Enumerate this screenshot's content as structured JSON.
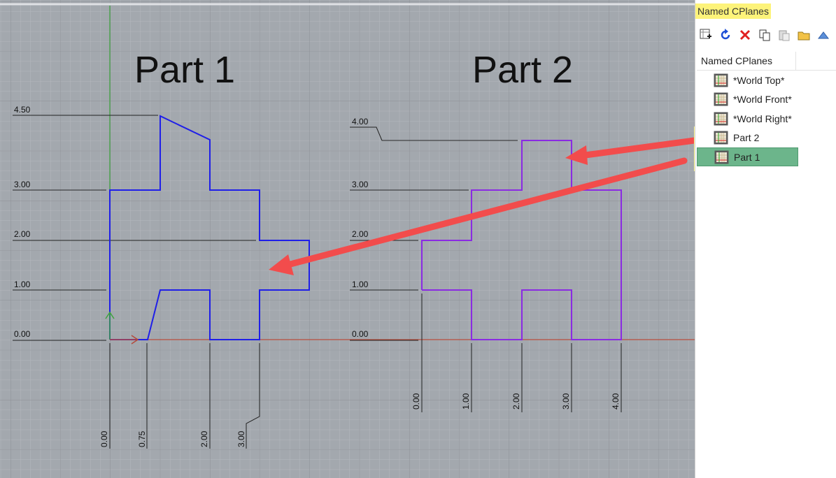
{
  "viewport": {
    "part1_title": "Part 1",
    "part2_title": "Part 2",
    "part1_y_labels": [
      "4.50",
      "3.00",
      "2.00",
      "1.00",
      "0.00"
    ],
    "part1_x_labels": [
      "0.00",
      "0.75",
      "2.00",
      "3.00"
    ],
    "part2_y_labels": [
      "4.00",
      "3.00",
      "2.00",
      "1.00",
      "0.00"
    ],
    "part2_x_labels": [
      "0.00",
      "1.00",
      "2.00",
      "3.00",
      "4.00"
    ],
    "colors": {
      "background": "#a3a8ae",
      "part1_outline": "#1f1fe8",
      "part2_outline": "#8a2be2",
      "annotation_arrow": "#f24c4c",
      "x_axis": "#b54a3a",
      "y_axis": "#3ea33e"
    }
  },
  "panel": {
    "title": "Named CPlanes",
    "toolbar": [
      {
        "name": "new-cplane-icon",
        "glyph": "⊞"
      },
      {
        "name": "restore-icon",
        "glyph": "↻"
      },
      {
        "name": "delete-icon",
        "glyph": "✕"
      },
      {
        "name": "copy-icon",
        "glyph": "❐"
      },
      {
        "name": "paste-icon",
        "glyph": "▤"
      },
      {
        "name": "open-folder-icon",
        "glyph": "▰"
      },
      {
        "name": "move-up-icon",
        "glyph": "▲"
      }
    ],
    "column_header": "Named CPlanes",
    "items": [
      {
        "label": "*World Top*",
        "icon": "cplane-grid-icon",
        "selected": false
      },
      {
        "label": "*World Front*",
        "icon": "cplane-grid-icon",
        "selected": false
      },
      {
        "label": "*World Right*",
        "icon": "cplane-grid-icon",
        "selected": false
      },
      {
        "label": "Part 2",
        "icon": "cplane-grid-icon",
        "selected": false
      },
      {
        "label": "Part 1",
        "icon": "cplane-grid-icon",
        "selected": true
      }
    ]
  }
}
